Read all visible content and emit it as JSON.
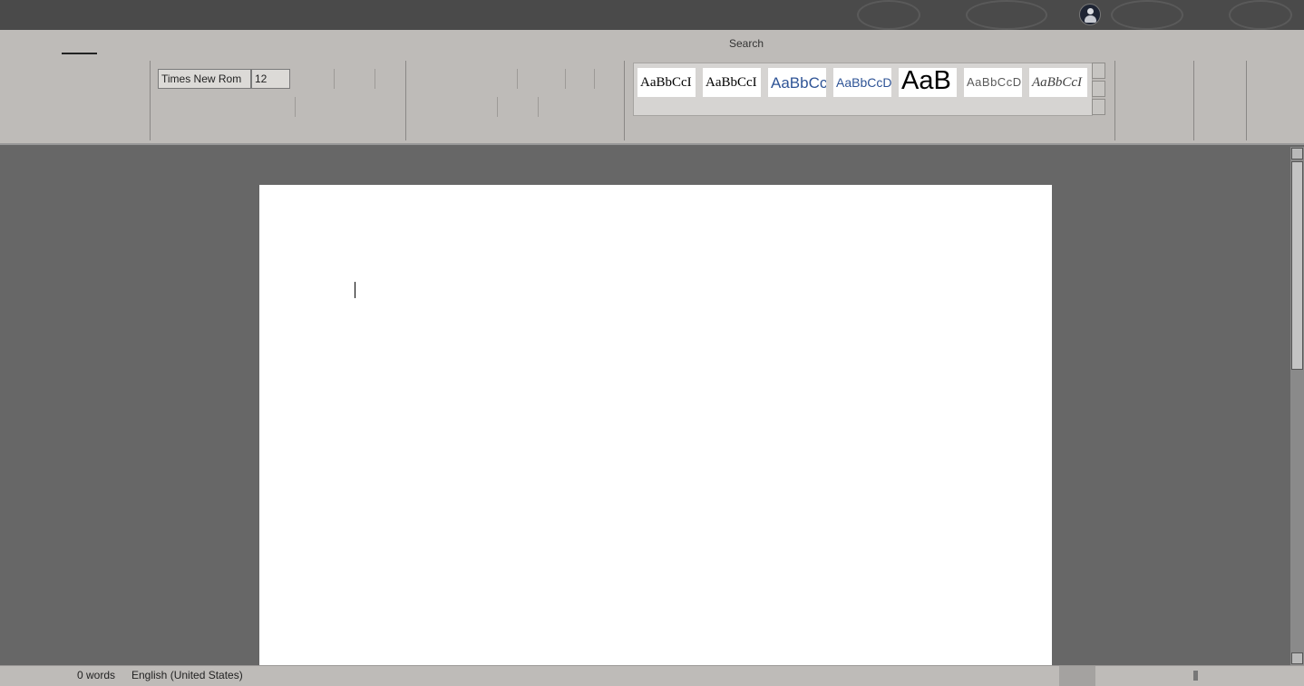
{
  "ribbon": {
    "search_label": "Search",
    "font_name": "Times New Rom",
    "font_size": "12",
    "styles": [
      {
        "sample": "AaBbCcI",
        "style": "normal-serif"
      },
      {
        "sample": "AaBbCcI",
        "style": "no-spacing-serif"
      },
      {
        "sample": "AaBbCc",
        "style": "heading1-blue"
      },
      {
        "sample": "AaBbCcD",
        "style": "heading2-blue"
      },
      {
        "sample": "AaB",
        "style": "title-large"
      },
      {
        "sample": "AaBbCcD",
        "style": "subtitle-gray"
      },
      {
        "sample": "AaBbCcI",
        "style": "emphasis-italic"
      }
    ]
  },
  "status": {
    "word_count": "0 words",
    "language": "English (United States)"
  },
  "colors": {
    "titlebar": "#4a4a4a",
    "ribbon": "#bebbb8",
    "canvas": "#676767",
    "page": "#ffffff",
    "heading_blue": "#2f5496"
  }
}
